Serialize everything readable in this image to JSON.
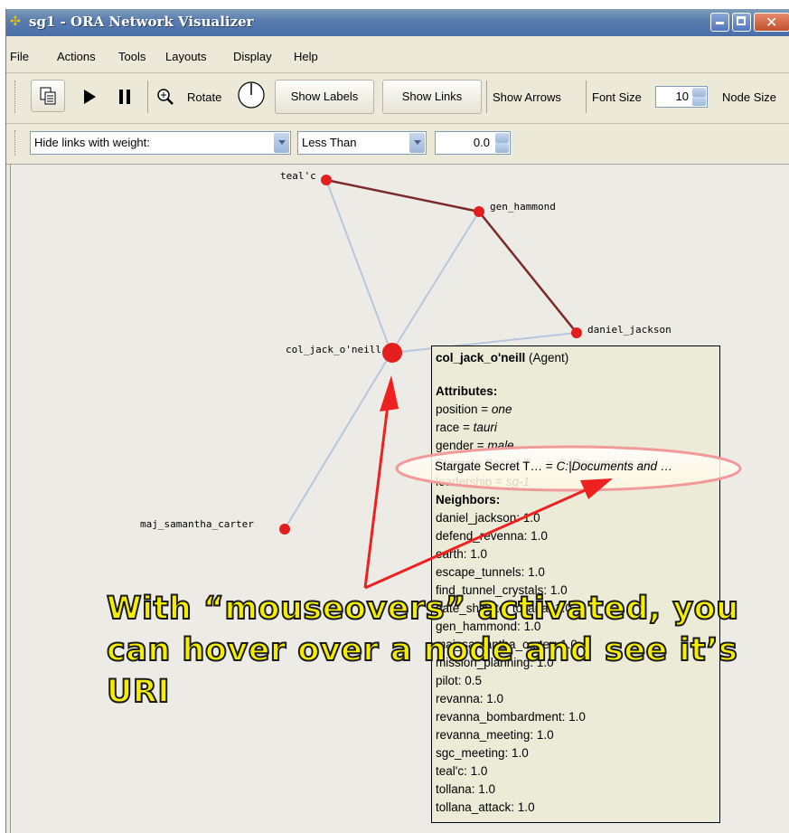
{
  "window": {
    "title": "sg1 - ORA Network Visualizer",
    "buttons": [
      "minimize",
      "maximize",
      "close"
    ]
  },
  "menu": [
    "File",
    "Actions",
    "Tools",
    "Layouts",
    "Display",
    "Help"
  ],
  "toolbar": {
    "rotate_label": "Rotate",
    "show_labels": "Show Labels",
    "show_links": "Show Links",
    "show_arrows": "Show Arrows",
    "font_size_label": "Font Size",
    "font_size_value": "10",
    "node_size_label": "Node Size"
  },
  "filter_bar": {
    "filter_select": "Hide links with weight:",
    "comparison_select": "Less Than",
    "threshold_value": "0.0"
  },
  "graph": {
    "nodes": {
      "tealc": "teal'c",
      "gen_hammond": "gen_hammond",
      "daniel_jackson": "daniel_jackson",
      "col_jack": "col_jack_o'neill",
      "maj_carter": "maj_samantha_carter"
    },
    "colors": {
      "node": "#e31e1e",
      "strong_link": "#7b2a2a",
      "weak_link": "#b8c6e0",
      "annotation_arrow": "#ee2020",
      "highlight_ellipse": "#f29a9a"
    }
  },
  "tooltip": {
    "node_name": "col_jack_o'neill",
    "node_type": "(Agent)",
    "attributes_heading": "Attributes:",
    "attributes": [
      {
        "key": "position = ",
        "value": "one"
      },
      {
        "key": "race = ",
        "value": "tauri"
      },
      {
        "key": "gender = ",
        "value": "male"
      },
      {
        "key": "Stargate Secret T… = ",
        "value": "C:|Documents and …"
      },
      {
        "key": "leadership = ",
        "value": "sg-1"
      }
    ],
    "neighbors_heading": "Neighbors:",
    "neighbors": [
      "daniel_jackson: 1.0",
      "defend_revenna: 1.0",
      "earth: 1.0",
      "escape_tunnels: 1.0",
      "find_tunnel_crystals: 1.0",
      "gate_ship_to_tollana: 1.0",
      "gen_hammond: 1.0",
      "maj_samantha_carter: 1.0",
      "mission_planning: 1.0",
      "pilot: 0.5",
      "revanna: 1.0",
      "revanna_bombardment: 1.0",
      "revanna_meeting: 1.0",
      "sgc_meeting: 1.0",
      "teal'c: 1.0",
      "tollana: 1.0",
      "tollana_attack: 1.0"
    ]
  },
  "callout": {
    "line1": "With “mouseovers” activated, you",
    "line2": "can hover over a node and see it’s",
    "line3": "URI"
  }
}
